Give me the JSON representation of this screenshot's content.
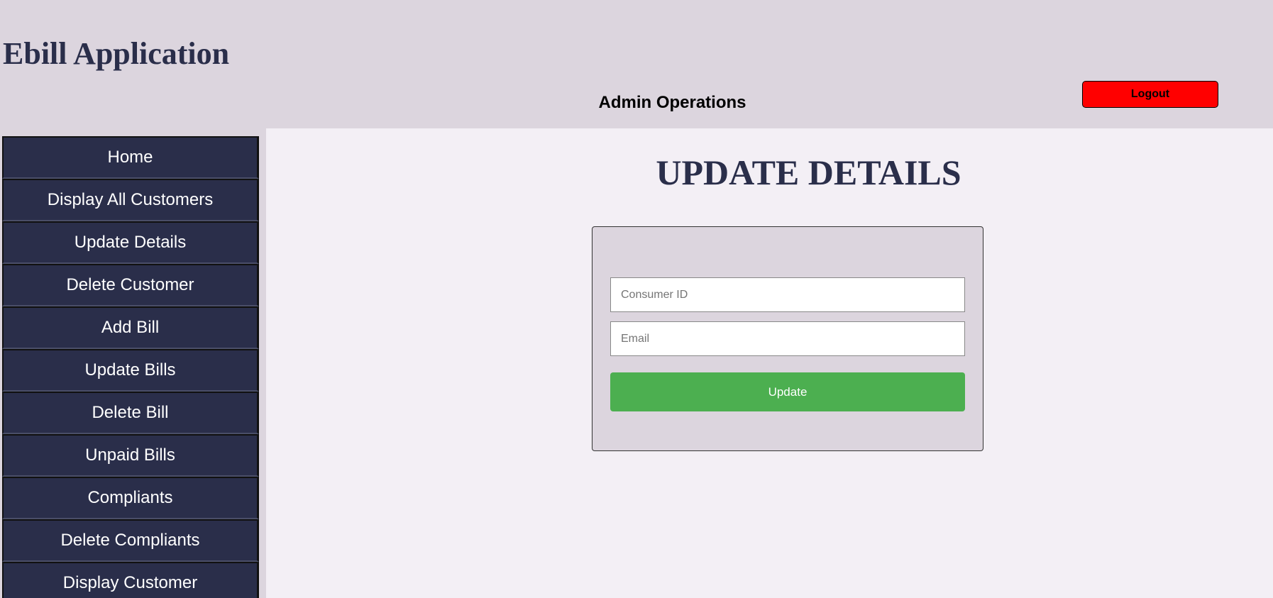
{
  "header": {
    "app_title": "Ebill Application",
    "section_title": "Admin Operations",
    "logout_label": "Logout"
  },
  "sidebar": {
    "items": [
      {
        "label": "Home"
      },
      {
        "label": "Display All Customers"
      },
      {
        "label": "Update Details"
      },
      {
        "label": "Delete Customer"
      },
      {
        "label": "Add Bill"
      },
      {
        "label": "Update Bills"
      },
      {
        "label": "Delete Bill"
      },
      {
        "label": "Unpaid Bills"
      },
      {
        "label": "Compliants"
      },
      {
        "label": "Delete Compliants"
      },
      {
        "label": "Display Customer"
      }
    ]
  },
  "main": {
    "heading": "UPDATE DETAILS",
    "form": {
      "consumer_id": {
        "value": "",
        "placeholder": "Consumer ID"
      },
      "email": {
        "value": "",
        "placeholder": "Email"
      },
      "submit_label": "Update"
    }
  },
  "colors": {
    "header_bg": "#dcd5de",
    "content_bg": "#f3eff5",
    "sidebar_bg": "#2a2e4a",
    "logout_bg": "#ff0000",
    "update_bg": "#4caf50",
    "title_color": "#2a2e4a"
  }
}
